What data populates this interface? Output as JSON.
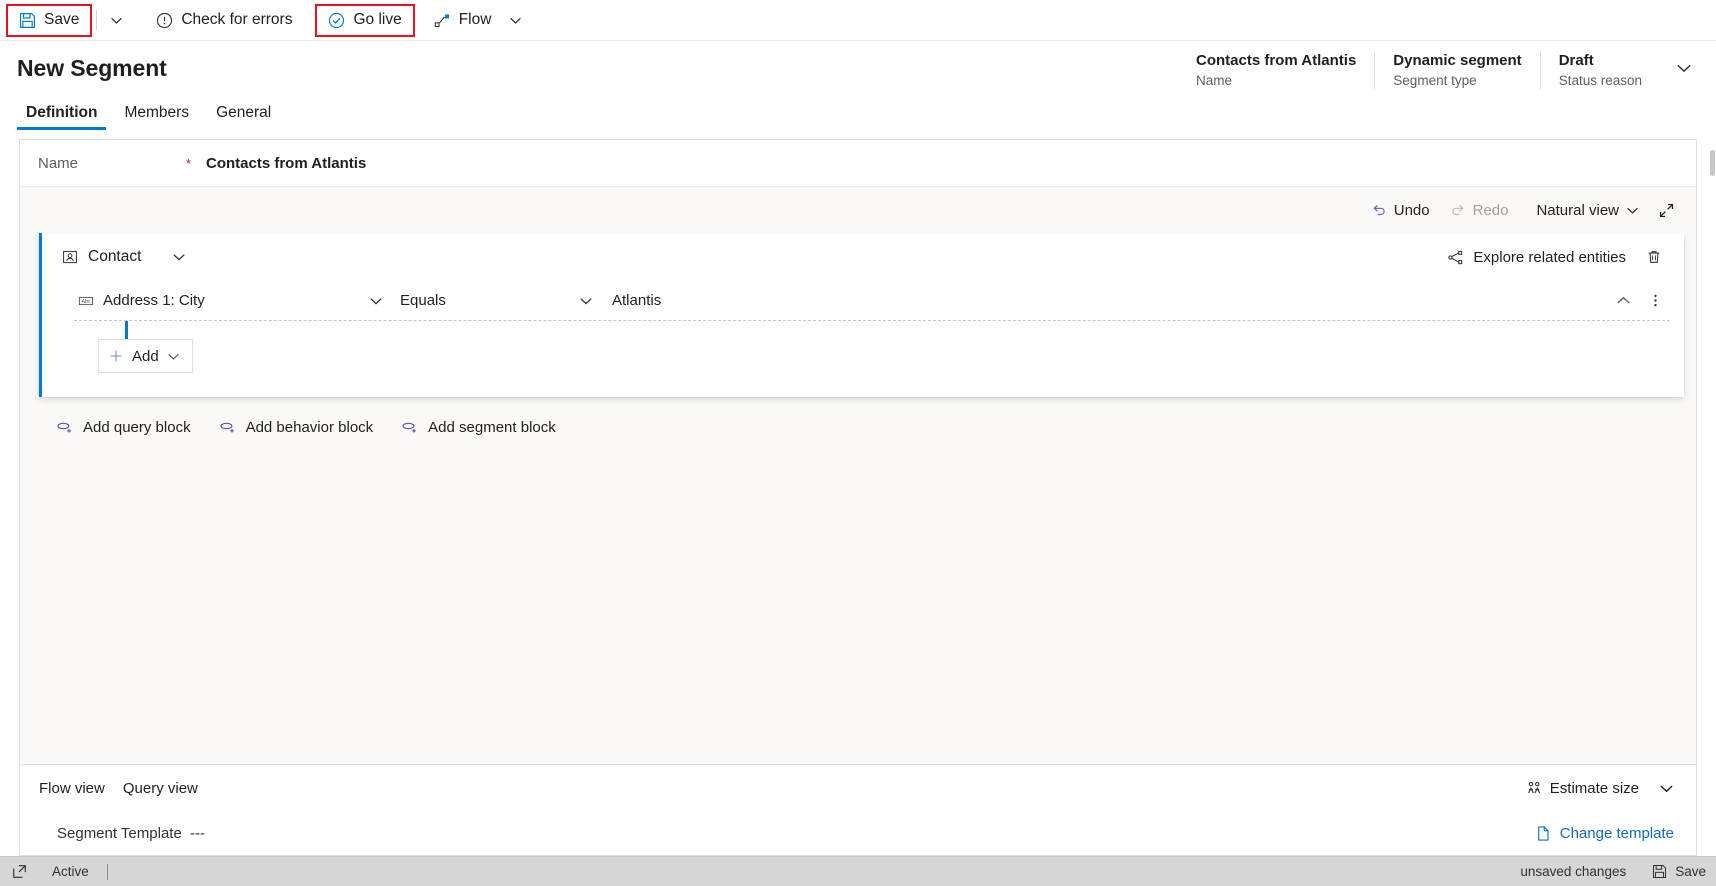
{
  "commandbar": {
    "save_label": "Save",
    "save_icon": "save-icon",
    "save_caret_icon": "chevron-down-icon",
    "check_errors_label": "Check for errors",
    "check_errors_icon": "exclamation-circle-icon",
    "go_live_label": "Go live",
    "go_live_icon": "check-circle-icon",
    "flow_label": "Flow",
    "flow_icon": "flow-icon",
    "flow_caret_icon": "chevron-down-icon",
    "highlight_color": "#e81123"
  },
  "header": {
    "title": "New Segment",
    "meta": [
      {
        "value": "Contacts from Atlantis",
        "label": "Name"
      },
      {
        "value": "Dynamic segment",
        "label": "Segment type"
      },
      {
        "value": "Draft",
        "label": "Status reason"
      }
    ],
    "expand_icon": "chevron-down-icon"
  },
  "tabs": [
    {
      "label": "Definition",
      "active": true
    },
    {
      "label": "Members",
      "active": false
    },
    {
      "label": "General",
      "active": false
    }
  ],
  "form": {
    "name_label": "Name",
    "required_marker": "*",
    "name_value": "Contacts from Atlantis"
  },
  "editor_toolbar": {
    "undo_label": "Undo",
    "undo_icon": "undo-icon",
    "redo_label": "Redo",
    "redo_icon": "redo-icon",
    "view_label": "Natural view",
    "view_caret_icon": "chevron-down-icon",
    "expand_icon": "expand-diagonal-icon",
    "undo_enabled": true,
    "redo_enabled": false,
    "accent_color": "#0078d4"
  },
  "block": {
    "entity_label": "Contact",
    "entity_icon": "contact-entity-icon",
    "collapse_icon": "chevron-down-icon",
    "explore_label": "Explore related entities",
    "explore_icon": "related-entities-icon",
    "delete_icon": "trash-icon",
    "condition": {
      "field": "Address 1: City",
      "field_icon": "abc-text-icon",
      "field_caret_icon": "chevron-down-icon",
      "operator": "Equals",
      "operator_caret_icon": "chevron-down-icon",
      "value": "Atlantis",
      "collapse_icon": "chevron-up-icon",
      "more_icon": "more-vertical-icon"
    },
    "add_label": "Add",
    "add_icon": "plus-icon",
    "add_caret_icon": "chevron-down-icon"
  },
  "block_links": [
    {
      "label": "Add query block",
      "icon": "add-query-icon"
    },
    {
      "label": "Add behavior block",
      "icon": "add-query-icon"
    },
    {
      "label": "Add segment block",
      "icon": "add-query-icon"
    }
  ],
  "bottom_panel": {
    "tabs": [
      {
        "label": "Flow view"
      },
      {
        "label": "Query view"
      }
    ],
    "estimate_label": "Estimate size",
    "estimate_icon": "people-icon",
    "estimate_caret_icon": "chevron-down-icon",
    "template_label": "Segment Template",
    "template_value": "---",
    "change_template_label": "Change template",
    "change_template_icon": "document-page-icon"
  },
  "statusbar": {
    "left_icon": "popout-icon",
    "state_label": "Active",
    "unsaved_label": "unsaved changes",
    "save_label": "Save",
    "save_icon": "save-icon"
  }
}
